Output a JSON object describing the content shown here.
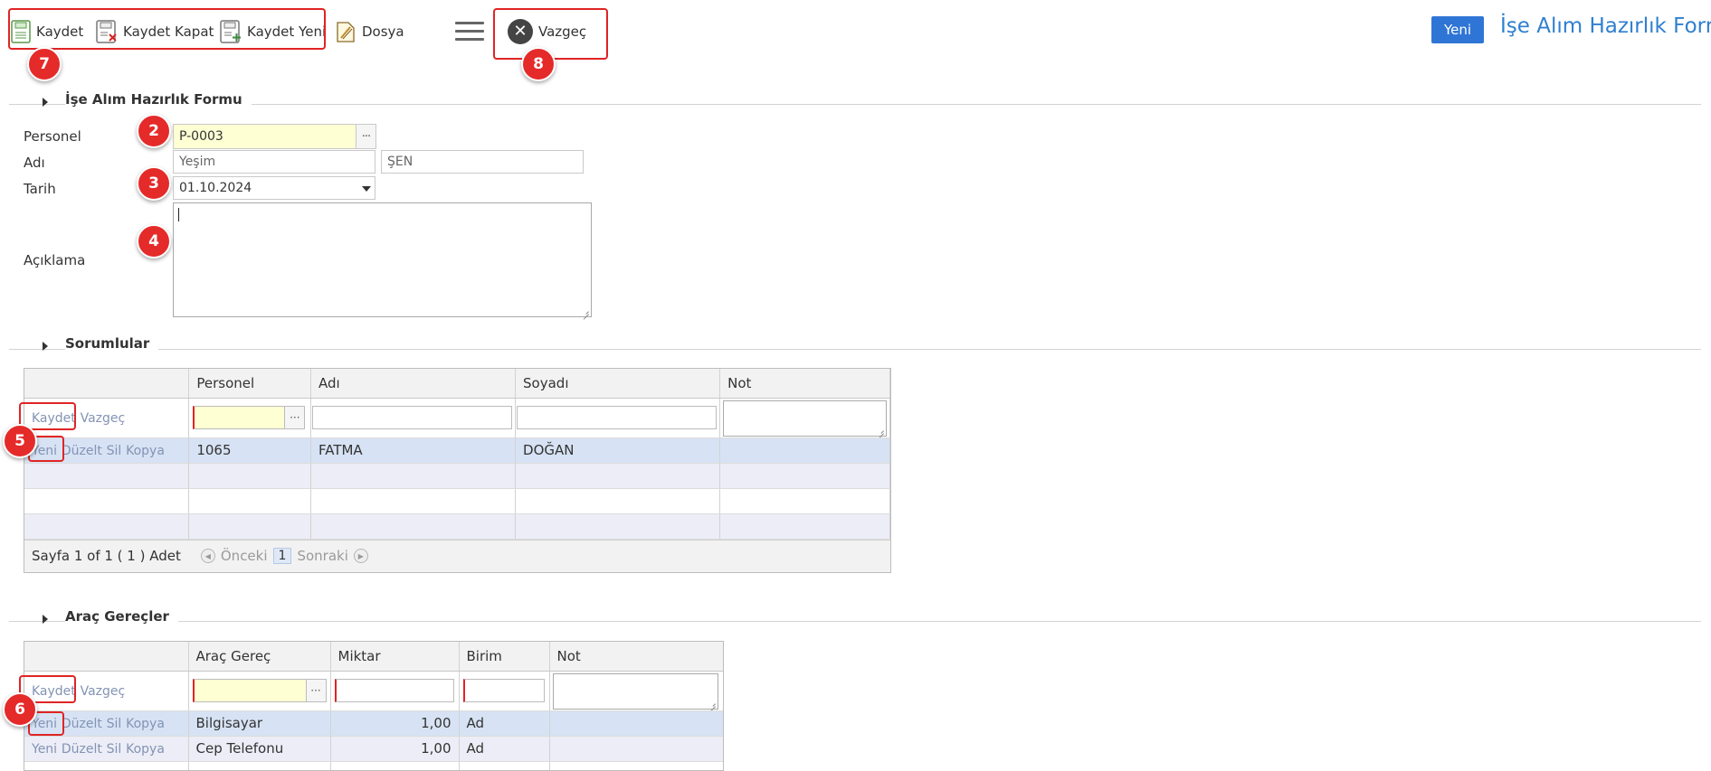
{
  "toolbar": {
    "save_label": "Kaydet",
    "save_close_label": "Kaydet Kapat",
    "save_new_label": "Kaydet Yeni",
    "file_label": "Dosya",
    "cancel_label": "Vazgeç",
    "cancel_glyph": "✕",
    "new_label": "Yeni",
    "form_title": "İşe Alım Hazırlık Formu"
  },
  "badges": {
    "b2": "2",
    "b3": "3",
    "b4": "4",
    "b5": "5",
    "b6": "6",
    "b7": "7",
    "b8": "8"
  },
  "form": {
    "section_title": "İşe Alım Hazırlık Formu",
    "personnel_label": "Personel",
    "personnel_value": "P-0003",
    "name_label": "Adı",
    "first_name": "Yeşim",
    "last_name": "ŞEN",
    "date_label": "Tarih",
    "date_value": "01.10.2024",
    "description_label": "Açıklama"
  },
  "responsibles": {
    "section_title": "Sorumlular",
    "columns": [
      "Personel",
      "Adı",
      "Soyadı",
      "Not"
    ],
    "edit_actions": {
      "save": "Kaydet",
      "cancel": "Vazgeç"
    },
    "row_actions": {
      "new": "Yeni",
      "edit": "Düzelt",
      "delete": "Sil",
      "copy": "Kopya"
    },
    "rows": [
      {
        "personnel": "1065",
        "first_name": "FATMA",
        "last_name": "DOĞAN",
        "note": ""
      }
    ],
    "pager": {
      "page_text": "Sayfa 1 of 1 ( 1 ) Adet",
      "prev_label": "Önceki",
      "current_page": "1",
      "next_label": "Sonraki"
    }
  },
  "tools": {
    "section_title": "Araç Gereçler",
    "columns": [
      "Araç Gereç",
      "Miktar",
      "Birim",
      "Not"
    ],
    "edit_actions": {
      "save": "Kaydet",
      "cancel": "Vazgeç"
    },
    "row_actions": {
      "new": "Yeni",
      "edit": "Düzelt",
      "delete": "Sil",
      "copy": "Kopya"
    },
    "rows": [
      {
        "item": "Bilgisayar",
        "quantity": "1,00",
        "unit": "Ad",
        "note": ""
      },
      {
        "item": "Cep Telefonu",
        "quantity": "1,00",
        "unit": "Ad",
        "note": ""
      }
    ]
  },
  "colors": {
    "accent": "#2f75d6",
    "title": "#2f7fd0",
    "highlight": "#e02424",
    "badge": "#e52a2a",
    "selected_row": "#d7e3f4",
    "required_field": "#ffffd4"
  }
}
